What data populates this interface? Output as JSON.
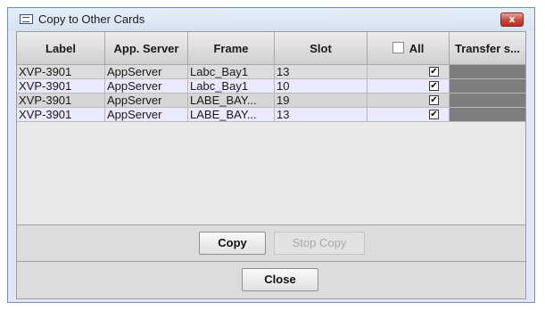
{
  "window": {
    "title": "Copy to Other Cards",
    "close_icon": "x"
  },
  "table": {
    "columns": [
      "Label",
      "App. Server",
      "Frame",
      "Slot",
      "All",
      "Transfer s..."
    ],
    "rows": [
      {
        "label": "XVP-3901",
        "app_server": "AppServer",
        "frame": "Labc_Bay1",
        "slot": "13",
        "checked": true
      },
      {
        "label": "XVP-3901",
        "app_server": "AppServer",
        "frame": "Labc_Bay1",
        "slot": "10",
        "checked": true
      },
      {
        "label": "XVP-3901",
        "app_server": "AppServer",
        "frame": "LABE_BAY...",
        "slot": "19",
        "checked": true
      },
      {
        "label": "XVP-3901",
        "app_server": "AppServer",
        "frame": "LABE_BAY...",
        "slot": "13",
        "checked": true
      }
    ],
    "row_colors": [
      "#dcdcdc",
      "#ebe9ff",
      "#d6d6d6",
      "#ebe9ff"
    ],
    "check_glyph": "✔"
  },
  "buttons": {
    "copy": "Copy",
    "stop_copy": "Stop Copy",
    "close": "Close"
  }
}
